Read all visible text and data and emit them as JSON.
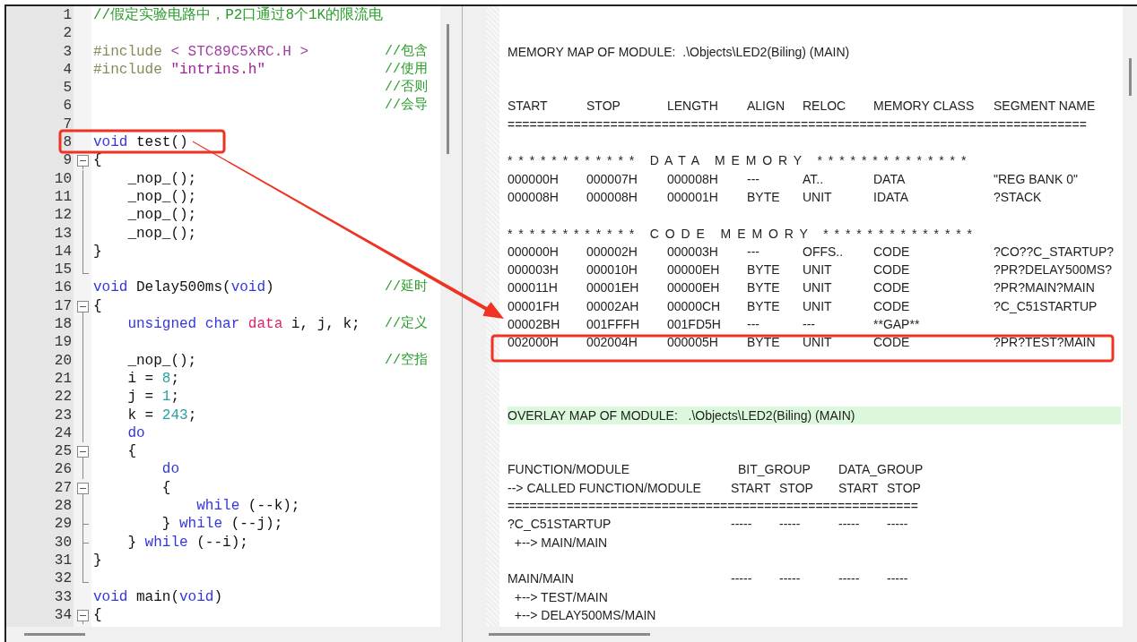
{
  "editor": {
    "lines": [
      {
        "n": "1",
        "code": [
          {
            "kind": "comment",
            "text": "//假定实验电路中，P2口通过8个1K的限流电"
          }
        ]
      },
      {
        "n": "2"
      },
      {
        "n": "3",
        "code": [
          {
            "kind": "preproc",
            "text": "#include"
          },
          {
            "kind": "header",
            "text": " < STC89C5xRC.H >"
          }
        ],
        "note": "//包含"
      },
      {
        "n": "4",
        "code": [
          {
            "kind": "preproc",
            "text": "#include"
          },
          {
            "kind": "string",
            "text": " \"intrins.h\""
          }
        ],
        "note": "//使用"
      },
      {
        "n": "5",
        "note": "//否则"
      },
      {
        "n": "6",
        "note": "//会导"
      },
      {
        "n": "7"
      },
      {
        "n": "8",
        "code": [
          {
            "kind": "keyword",
            "text": "void"
          },
          {
            "kind": "plain",
            "text": " test()"
          }
        ]
      },
      {
        "n": "9",
        "fold": {
          "kind": "start"
        },
        "code": [
          {
            "kind": "plain",
            "text": "{"
          }
        ]
      },
      {
        "n": "10",
        "fold": {
          "kind": "line"
        },
        "code": [
          {
            "kind": "plain",
            "text": "    _nop_();"
          }
        ]
      },
      {
        "n": "11",
        "fold": {
          "kind": "line"
        },
        "code": [
          {
            "kind": "plain",
            "text": "    _nop_();"
          }
        ]
      },
      {
        "n": "12",
        "fold": {
          "kind": "line"
        },
        "code": [
          {
            "kind": "plain",
            "text": "    _nop_();"
          }
        ]
      },
      {
        "n": "13",
        "fold": {
          "kind": "line"
        },
        "code": [
          {
            "kind": "plain",
            "text": "    _nop_();"
          }
        ]
      },
      {
        "n": "14",
        "fold": {
          "kind": "line"
        },
        "code": [
          {
            "kind": "plain",
            "text": "}"
          }
        ]
      },
      {
        "n": "15",
        "fold": {
          "kind": "end"
        }
      },
      {
        "n": "16",
        "code": [
          {
            "kind": "keyword",
            "text": "void"
          },
          {
            "kind": "plain",
            "text": " Delay500ms("
          },
          {
            "kind": "keyword",
            "text": "void"
          },
          {
            "kind": "plain",
            "text": ")"
          }
        ],
        "note": "//延时"
      },
      {
        "n": "17",
        "fold": {
          "kind": "start"
        },
        "code": [
          {
            "kind": "plain",
            "text": "{"
          }
        ]
      },
      {
        "n": "18",
        "fold": {
          "kind": "line"
        },
        "code": [
          {
            "kind": "keyword",
            "text": "    unsigned char"
          },
          {
            "kind": "qualifier",
            "text": " data"
          },
          {
            "kind": "plain",
            "text": " i, j, k;"
          }
        ],
        "note": "//定义"
      },
      {
        "n": "19",
        "fold": {
          "kind": "line"
        }
      },
      {
        "n": "20",
        "fold": {
          "kind": "line"
        },
        "code": [
          {
            "kind": "plain",
            "text": "    _nop_();"
          }
        ],
        "note": "//空指"
      },
      {
        "n": "21",
        "fold": {
          "kind": "line"
        },
        "code": [
          {
            "kind": "plain",
            "text": "    i = "
          },
          {
            "kind": "number",
            "text": "8"
          },
          {
            "kind": "plain",
            "text": ";"
          }
        ]
      },
      {
        "n": "22",
        "fold": {
          "kind": "line"
        },
        "code": [
          {
            "kind": "plain",
            "text": "    j = "
          },
          {
            "kind": "number",
            "text": "1"
          },
          {
            "kind": "plain",
            "text": ";"
          }
        ]
      },
      {
        "n": "23",
        "fold": {
          "kind": "line"
        },
        "code": [
          {
            "kind": "plain",
            "text": "    k = "
          },
          {
            "kind": "number",
            "text": "243"
          },
          {
            "kind": "plain",
            "text": ";"
          }
        ]
      },
      {
        "n": "24",
        "fold": {
          "kind": "line"
        },
        "code": [
          {
            "kind": "keyword",
            "text": "    do"
          }
        ]
      },
      {
        "n": "25",
        "fold": {
          "kind": "start"
        },
        "code": [
          {
            "kind": "plain",
            "text": "    {"
          }
        ]
      },
      {
        "n": "26",
        "fold": {
          "kind": "line"
        },
        "code": [
          {
            "kind": "keyword",
            "text": "        do"
          }
        ]
      },
      {
        "n": "27",
        "fold": {
          "kind": "start"
        },
        "code": [
          {
            "kind": "plain",
            "text": "        {"
          }
        ]
      },
      {
        "n": "28",
        "fold": {
          "kind": "line"
        },
        "code": [
          {
            "kind": "keyword",
            "text": "            while"
          },
          {
            "kind": "plain",
            "text": " (--k);"
          }
        ]
      },
      {
        "n": "29",
        "fold": {
          "kind": "tick"
        },
        "code": [
          {
            "kind": "plain",
            "text": "        } "
          },
          {
            "kind": "keyword",
            "text": "while"
          },
          {
            "kind": "plain",
            "text": " (--j);"
          }
        ]
      },
      {
        "n": "30",
        "fold": {
          "kind": "tick"
        },
        "code": [
          {
            "kind": "plain",
            "text": "    } "
          },
          {
            "kind": "keyword",
            "text": "while"
          },
          {
            "kind": "plain",
            "text": " (--i);"
          }
        ]
      },
      {
        "n": "31",
        "fold": {
          "kind": "line"
        },
        "code": [
          {
            "kind": "plain",
            "text": "}"
          }
        ]
      },
      {
        "n": "32",
        "fold": {
          "kind": "end"
        }
      },
      {
        "n": "33",
        "code": [
          {
            "kind": "keyword",
            "text": "void"
          },
          {
            "kind": "plain",
            "text": " main("
          },
          {
            "kind": "keyword",
            "text": "void"
          },
          {
            "kind": "plain",
            "text": ")"
          }
        ]
      },
      {
        "n": "34",
        "fold": {
          "kind": "start"
        },
        "code": [
          {
            "kind": "plain",
            "text": "{"
          }
        ]
      }
    ]
  },
  "map_file": {
    "lines": [
      {
        "kind": "blank"
      },
      {
        "kind": "blank"
      },
      {
        "kind": "text",
        "text": "MEMORY MAP OF MODULE:  .\\Objects\\LED2(Biling) (MAIN)"
      },
      {
        "kind": "blank"
      },
      {
        "kind": "blank"
      },
      {
        "kind": "columns",
        "cells": [
          "START",
          "STOP",
          "LENGTH",
          "ALIGN",
          "RELOC",
          "MEMORY CLASS",
          "SEGMENT NAME"
        ]
      },
      {
        "kind": "rule",
        "text": "==============================================================================="
      },
      {
        "kind": "blank"
      },
      {
        "kind": "banner",
        "text": "* * * * * * * * * * * *   D A T A   M E M O R Y   * * * * * * * * * * * * * *"
      },
      {
        "kind": "columns",
        "cells": [
          "000000H",
          "000007H",
          "000008H",
          "---",
          "AT..",
          "DATA",
          "\"REG BANK 0\""
        ]
      },
      {
        "kind": "columns",
        "cells": [
          "000008H",
          "000008H",
          "000001H",
          "BYTE",
          "UNIT",
          "IDATA",
          "?STACK"
        ]
      },
      {
        "kind": "blank"
      },
      {
        "kind": "banner",
        "text": "* * * * * * * * * * * *   C O D E   M E M O R Y   * * * * * * * * * * * * * *"
      },
      {
        "kind": "columns",
        "cells": [
          "000000H",
          "000002H",
          "000003H",
          "---",
          "OFFS..",
          "CODE",
          "?CO??C_STARTUP?"
        ]
      },
      {
        "kind": "columns",
        "cells": [
          "000003H",
          "000010H",
          "00000EH",
          "BYTE",
          "UNIT",
          "CODE",
          "?PR?DELAY500MS?"
        ]
      },
      {
        "kind": "columns",
        "cells": [
          "000011H",
          "00001EH",
          "00000EH",
          "BYTE",
          "UNIT",
          "CODE",
          "?PR?MAIN?MAIN"
        ]
      },
      {
        "kind": "columns",
        "cells": [
          "00001FH",
          "00002AH",
          "00000CH",
          "BYTE",
          "UNIT",
          "CODE",
          "?C_C51STARTUP"
        ]
      },
      {
        "kind": "columns",
        "cells": [
          "00002BH",
          "001FFFH",
          "001FD5H",
          "---",
          "---",
          "**GAP**"
        ]
      },
      {
        "kind": "columns",
        "cells": [
          "002000H",
          "002004H",
          "000005H",
          "BYTE",
          "UNIT",
          "CODE",
          "?PR?TEST?MAIN"
        ]
      },
      {
        "kind": "blank"
      },
      {
        "kind": "blank"
      },
      {
        "kind": "blank"
      },
      {
        "kind": "current",
        "text": "OVERLAY MAP OF MODULE:   .\\Objects\\LED2(Biling) (MAIN)"
      },
      {
        "kind": "blank"
      },
      {
        "kind": "blank"
      },
      {
        "kind": "groups",
        "text": "FUNCTION/MODULE",
        "cells": [
          "BIT_GROUP",
          "DATA_GROUP"
        ]
      },
      {
        "kind": "overlay",
        "text": "--> CALLED FUNCTION/MODULE",
        "cells": [
          "START",
          "STOP",
          "START",
          "STOP"
        ]
      },
      {
        "kind": "rule",
        "text": "========================================================"
      },
      {
        "kind": "overlay",
        "text": "?C_C51STARTUP",
        "cells": [
          "-----",
          "-----",
          "-----",
          "-----"
        ]
      },
      {
        "kind": "text",
        "text": "  +--> MAIN/MAIN"
      },
      {
        "kind": "blank"
      },
      {
        "kind": "overlay",
        "text": "MAIN/MAIN",
        "cells": [
          "-----",
          "-----",
          "-----",
          "-----"
        ]
      },
      {
        "kind": "text",
        "text": "  +--> TEST/MAIN"
      },
      {
        "kind": "text",
        "text": "  +--> DELAY500MS/MAIN"
      }
    ]
  }
}
